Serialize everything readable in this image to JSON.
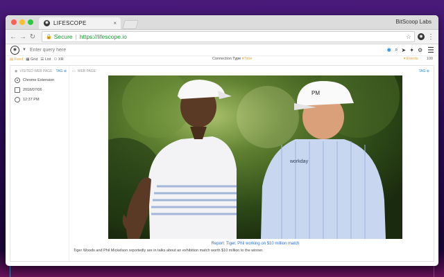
{
  "browser": {
    "tab_title": "LIFESCOPE",
    "tab_close": "×",
    "profile_name": "BitScoop Labs",
    "address": {
      "secure_label": "Secure",
      "url": "https://lifescope.io"
    },
    "icons": {
      "back": "arrow-left-icon",
      "forward": "arrow-right-icon",
      "reload": "reload-icon",
      "lock": "lock-icon",
      "star": "star-icon",
      "menu": "more-vert-icon"
    }
  },
  "app": {
    "search": {
      "placeholder": "Enter query here"
    },
    "filters": {
      "feed": "Feed",
      "grid": "Grid",
      "list": "List",
      "xr": "XR",
      "connection": "Connection",
      "type": "Type",
      "time": "Time",
      "events": "Events",
      "count": "100"
    }
  },
  "event": {
    "left_header": "VISITED WEB PAGE",
    "left_tag": "TAG",
    "source": "Chrome Extension",
    "date": "2018/07/06",
    "time": "12:37 PM",
    "right_header": "WEB PAGE",
    "right_tag": "TAG",
    "caption": "Report: Tiger, Phil working on $10 million match",
    "description": "Tiger Woods and Phil Mickelson reportedly are in talks about an exhibition match worth $10 million to the winner."
  },
  "colors": {
    "accent": "#e3a33a",
    "link": "#2a6fd0",
    "secure": "#1a9a32"
  }
}
